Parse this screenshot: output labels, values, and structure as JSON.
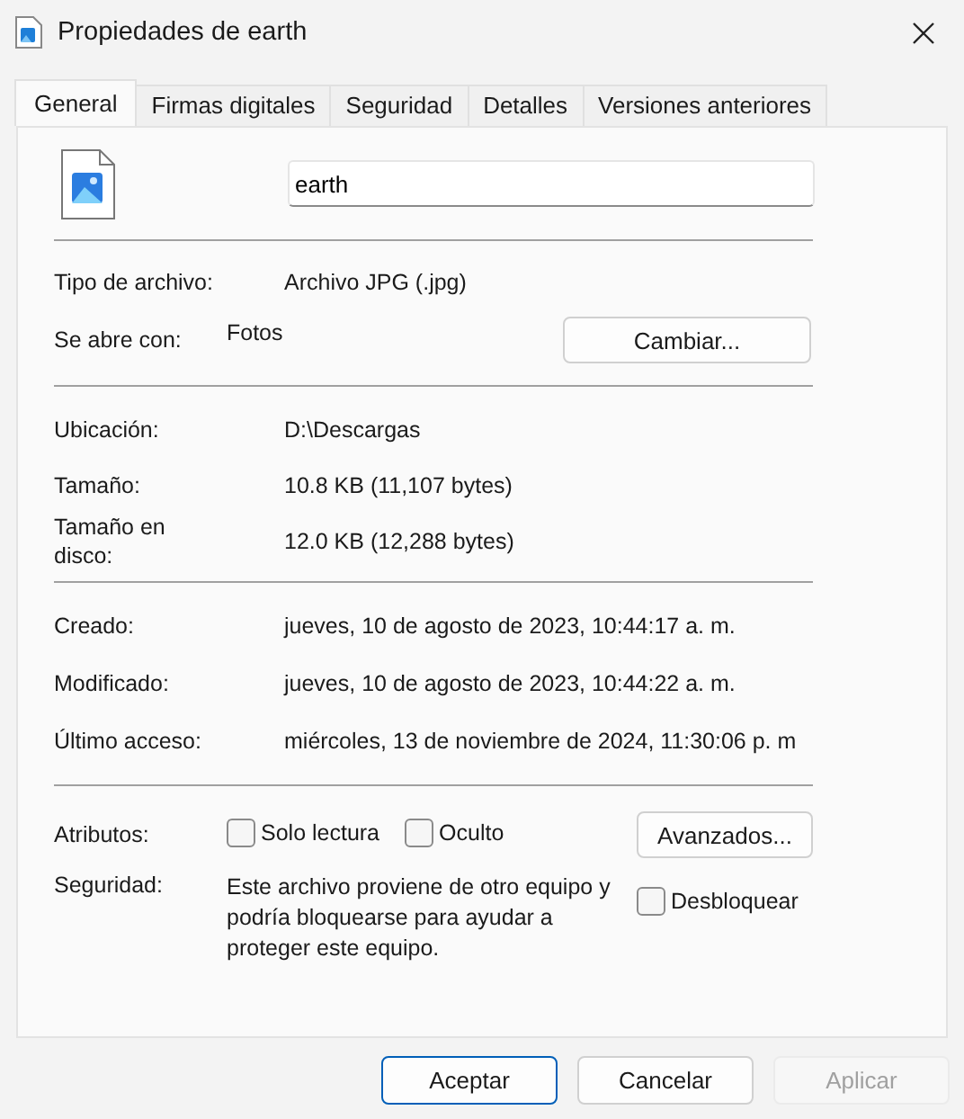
{
  "window": {
    "title": "Propiedades de earth"
  },
  "tabs": [
    {
      "label": "General",
      "selected": true
    },
    {
      "label": "Firmas digitales",
      "selected": false
    },
    {
      "label": "Seguridad",
      "selected": false
    },
    {
      "label": "Detalles",
      "selected": false
    },
    {
      "label": "Versiones anteriores",
      "selected": false
    }
  ],
  "file_name": {
    "value": "earth"
  },
  "file_type": {
    "label": "Tipo de archivo:",
    "value": "Archivo JPG (.jpg)"
  },
  "opens_with": {
    "label": "Se abre con:",
    "value": "Fotos",
    "button": "Cambiar..."
  },
  "location_rows": [
    {
      "label": "Ubicación:",
      "value": "D:\\Descargas"
    },
    {
      "label": "Tamaño:",
      "value": "10.8 KB (11,107 bytes)"
    },
    {
      "label": "Tamaño en disco:",
      "value": "12.0 KB (12,288 bytes)"
    }
  ],
  "date_rows": [
    {
      "label": "Creado:",
      "value": "jueves, 10 de agosto de 2023, 10:44:17 a. m."
    },
    {
      "label": "Modificado:",
      "value": "jueves, 10 de agosto de 2023, 10:44:22 a. m."
    },
    {
      "label": "Último acceso:",
      "value": "miércoles, 13 de noviembre de 2024, 11:30:06 p. m"
    }
  ],
  "attributes": {
    "label": "Atributos:",
    "checkboxes": [
      {
        "label": "Solo lectura",
        "checked": false
      },
      {
        "label": "Oculto",
        "checked": false
      }
    ],
    "button": "Avanzados..."
  },
  "security": {
    "label": "Seguridad:",
    "text": "Este archivo proviene de otro equipo y podría bloquearse para ayudar a proteger este equipo.",
    "checkbox": {
      "label": "Desbloquear",
      "checked": false
    }
  },
  "buttons": [
    {
      "label": "Aceptar",
      "default": true,
      "disabled": false
    },
    {
      "label": "Cancelar",
      "default": false,
      "disabled": false
    },
    {
      "label": "Aplicar",
      "default": false,
      "disabled": true
    }
  ]
}
